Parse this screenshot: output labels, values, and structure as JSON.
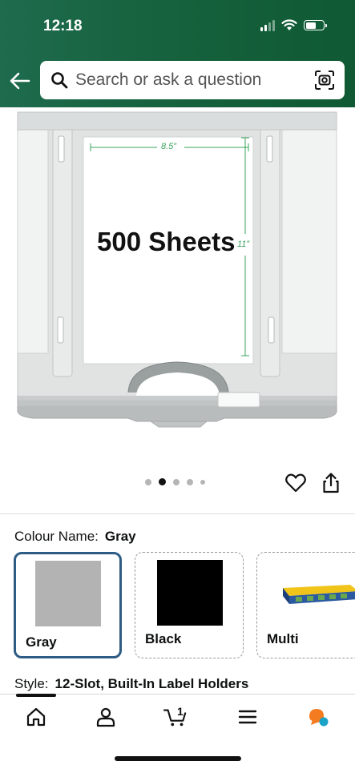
{
  "status_bar": {
    "time": "12:18"
  },
  "search": {
    "placeholder": "Search or ask a question",
    "value": ""
  },
  "product_image": {
    "label": "500 Sheets",
    "width_dim": "8.5”",
    "height_dim": "11”"
  },
  "carousel": {
    "count": 5,
    "active_index": 1
  },
  "colour": {
    "label": "Colour Name:",
    "selected": "Gray",
    "options": [
      {
        "name": "Gray",
        "color": "#b3b3b3"
      },
      {
        "name": "Black",
        "color": "#000000"
      },
      {
        "name": "Multi",
        "color": "#3a6da6"
      }
    ]
  },
  "style": {
    "label": "Style:",
    "value": "12-Slot, Built-In Label Holders"
  },
  "nav": {
    "cart_count": "1"
  },
  "colors": {
    "header_green": "#17633f",
    "selected_border": "#2e5c85"
  }
}
